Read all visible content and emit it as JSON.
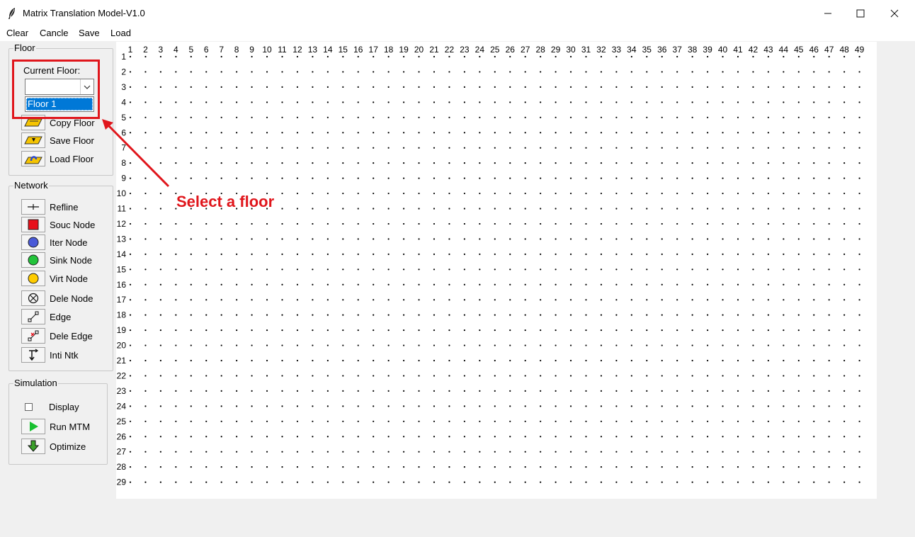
{
  "window": {
    "title": "Matrix Translation Model-V1.0",
    "controls": [
      "minimize",
      "maximize",
      "close"
    ]
  },
  "menu": [
    "Clear",
    "Cancle",
    "Save",
    "Load"
  ],
  "floor_panel": {
    "label": "Floor",
    "current_floor_label": "Current Floor:",
    "combo_value": "",
    "dropdown_options": [
      "Floor 1"
    ],
    "buttons": [
      {
        "label": "Copy Floor",
        "icon": "copy-floor-icon"
      },
      {
        "label": "Save Floor",
        "icon": "save-floor-icon"
      },
      {
        "label": "Load Floor",
        "icon": "load-floor-icon"
      }
    ]
  },
  "network_panel": {
    "label": "Network",
    "buttons": [
      {
        "label": "Refline",
        "icon": "refline-icon"
      },
      {
        "label": "Souc Node",
        "icon": "source-node-icon",
        "color": "#e8101a"
      },
      {
        "label": "Iter Node",
        "icon": "iter-node-icon",
        "color": "#4a5ad8"
      },
      {
        "label": "Sink Node",
        "icon": "sink-node-icon",
        "color": "#22c33a"
      },
      {
        "label": "Virt Node",
        "icon": "virtual-node-icon",
        "color": "#ffcc00"
      },
      {
        "label": "Dele Node",
        "icon": "delete-node-icon"
      },
      {
        "label": "Edge",
        "icon": "edge-icon"
      },
      {
        "label": "Dele Edge",
        "icon": "delete-edge-icon"
      },
      {
        "label": "Inti Ntk",
        "icon": "init-network-icon"
      }
    ]
  },
  "simulation_panel": {
    "label": "Simulation",
    "display_checkbox": {
      "label": "Display",
      "checked": false
    },
    "buttons": [
      {
        "label": "Run MTM",
        "icon": "play-icon",
        "color": "#18c030"
      },
      {
        "label": "Optimize",
        "icon": "down-arrow-icon",
        "color": "#3aa02a"
      }
    ]
  },
  "grid": {
    "columns": 49,
    "rows": 29
  },
  "annotation": {
    "text": "Select a floor",
    "color": "#e0161c"
  }
}
